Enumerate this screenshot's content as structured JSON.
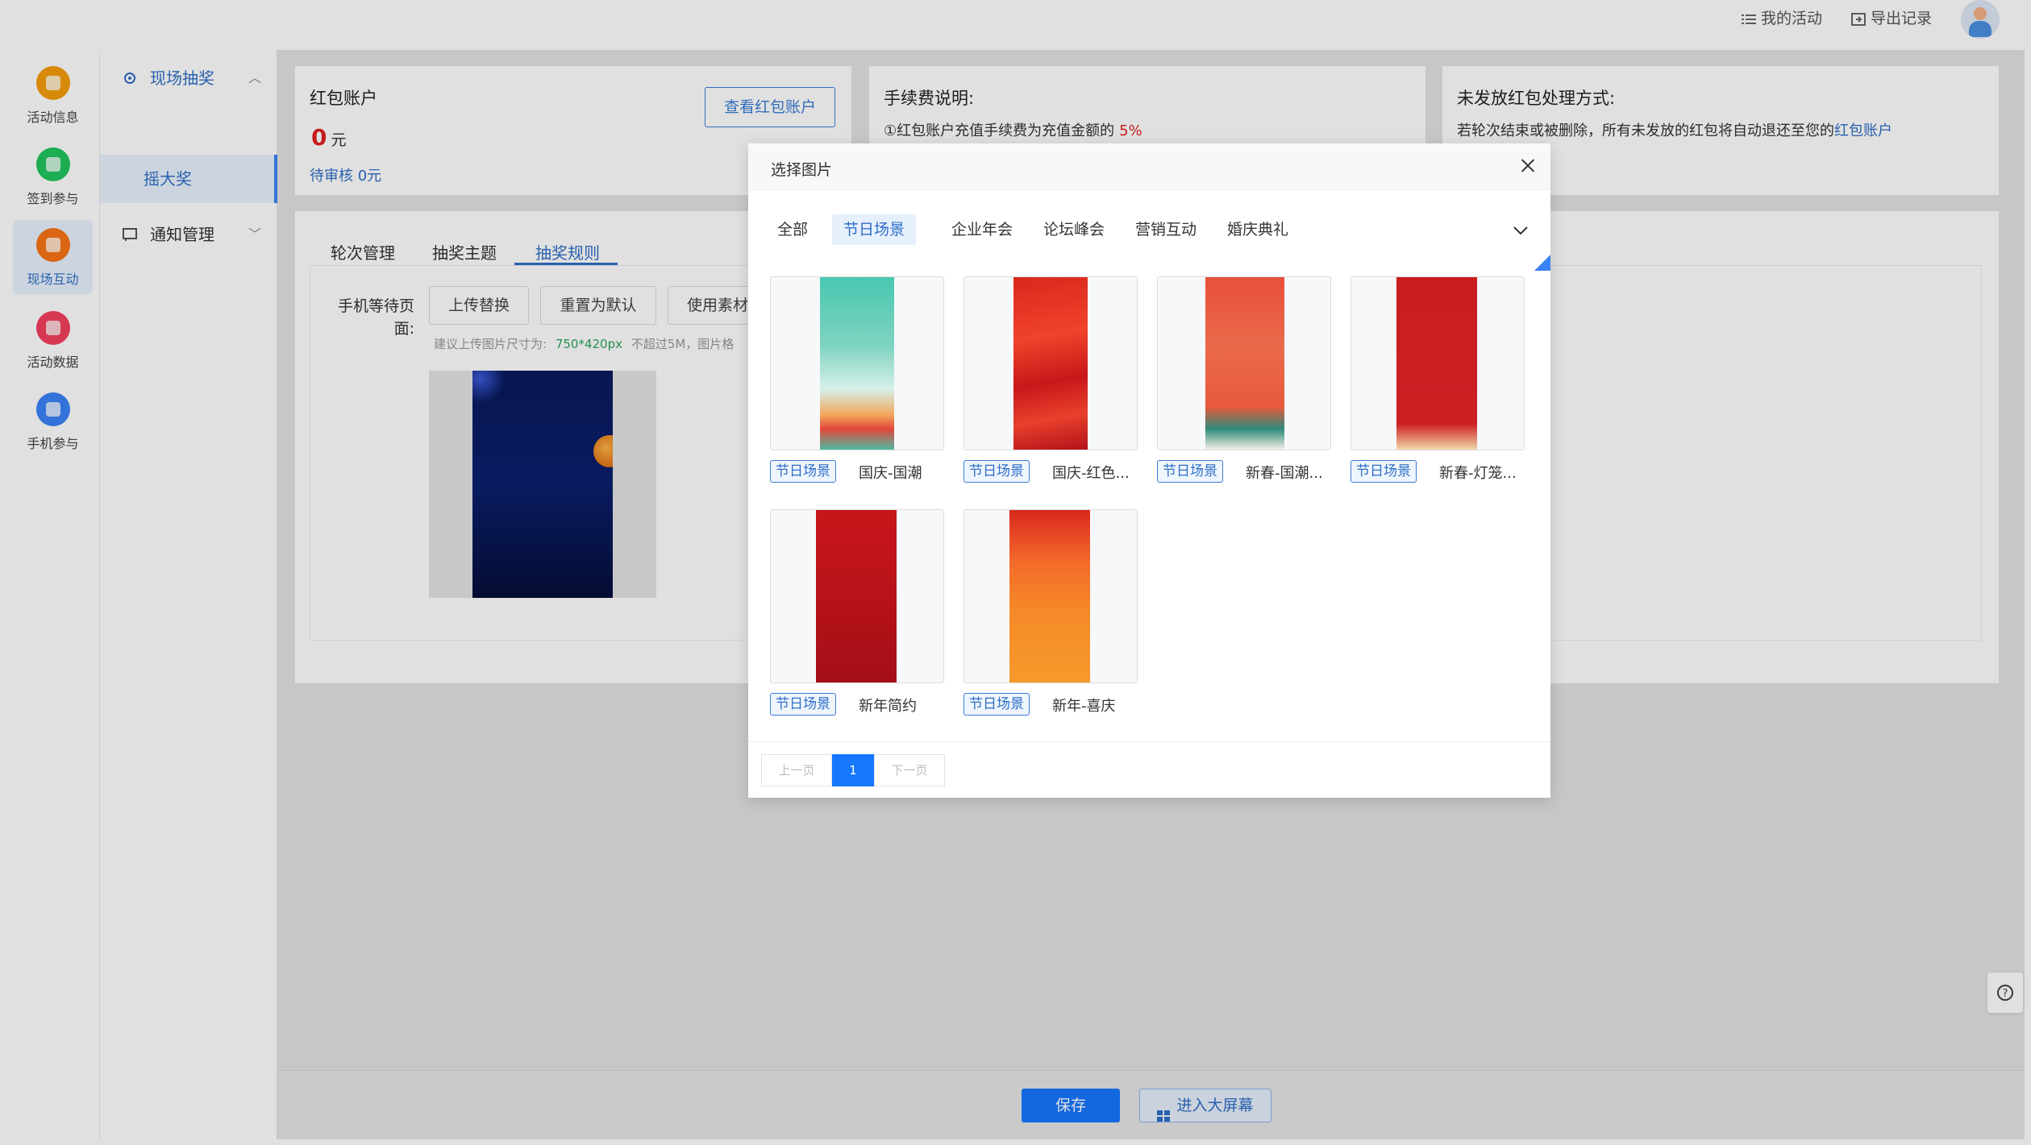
{
  "topbar": {
    "my_activity": "我的活动",
    "export_records": "导出记录"
  },
  "rail": {
    "items": [
      {
        "label": "活动信息",
        "color": "#f59e0b"
      },
      {
        "label": "签到参与",
        "color": "#22c55e"
      },
      {
        "label": "现场互动",
        "color": "#f97316"
      },
      {
        "label": "活动数据",
        "color": "#f43f5e"
      },
      {
        "label": "手机参与",
        "color": "#3b82f6"
      }
    ],
    "active_index": 2
  },
  "subnav": {
    "group1": "现场抽奖",
    "group1_sub": "摇大奖",
    "group2": "通知管理"
  },
  "redpacket": {
    "title": "红包账户",
    "amount": "0",
    "unit": "元",
    "pending": "待审核 0元",
    "view_button": "查看红包账户"
  },
  "fee": {
    "title": "手续费说明:",
    "text": "①红包账户充值手续费为充值金额的",
    "rate": "5%"
  },
  "unsent": {
    "title": "未发放红包处理方式:",
    "text": "若轮次结束或被删除，所有未发放的红包将自动退还至您的",
    "link": "红包账户"
  },
  "tabs": {
    "items": [
      "轮次管理",
      "抽奖主题",
      "抽奖规则"
    ],
    "active_index": 2
  },
  "form": {
    "wait_label_1": "手机等待页",
    "wait_label_2": "面:",
    "upload": "上传替换",
    "reset": "重置为默认",
    "use_material": "使用素材",
    "hint_prefix": "建议上传图片尺寸为:",
    "hint_size": "750*420px",
    "hint_suffix": "不超过5M，图片格"
  },
  "modal": {
    "title": "选择图片",
    "categories": [
      "全部",
      "节日场景",
      "企业年会",
      "论坛峰会",
      "营销互动",
      "婚庆典礼"
    ],
    "active_category": 1,
    "images": [
      {
        "tag": "节日场景",
        "name": "国庆-国潮"
      },
      {
        "tag": "节日场景",
        "name": "国庆-红色..."
      },
      {
        "tag": "节日场景",
        "name": "新春-国潮..."
      },
      {
        "tag": "节日场景",
        "name": "新春-灯笼..."
      },
      {
        "tag": "节日场景",
        "name": "新年简约"
      },
      {
        "tag": "节日场景",
        "name": "新年-喜庆"
      }
    ],
    "pager": {
      "prev": "上一页",
      "current": "1",
      "next": "下一页"
    }
  },
  "bottom": {
    "save": "保存",
    "enter_screen": "进入大屏幕"
  },
  "colors": {
    "primary": "#1677ff",
    "danger": "#e02020",
    "green_hint": "#2aa65a"
  }
}
